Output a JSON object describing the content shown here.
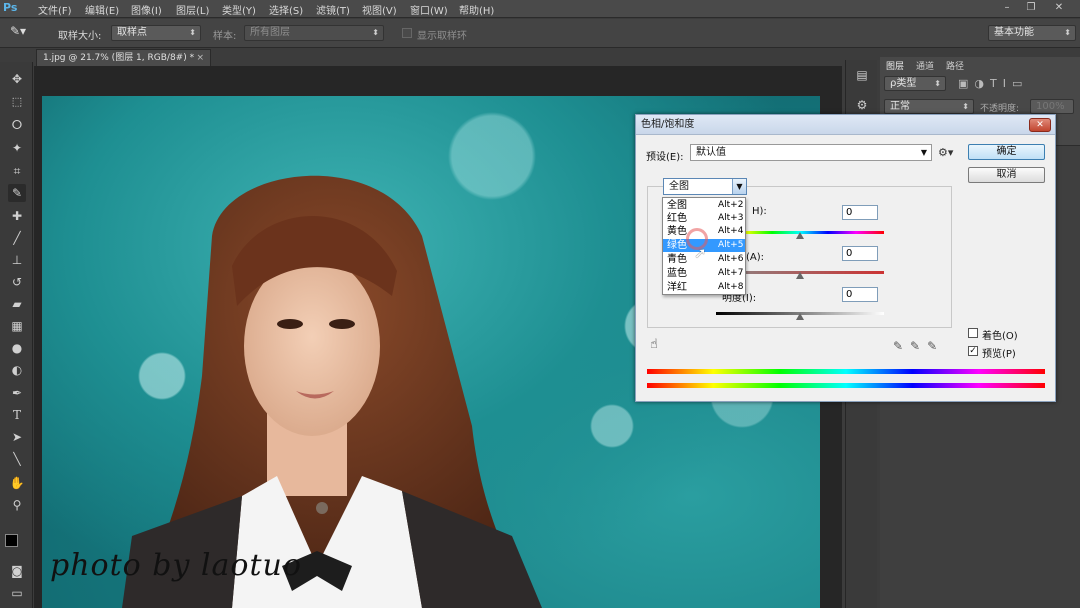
{
  "app": {
    "logo": "Ps"
  },
  "menu": [
    {
      "label": "文件(F)"
    },
    {
      "label": "编辑(E)"
    },
    {
      "label": "图像(I)"
    },
    {
      "label": "图层(L)"
    },
    {
      "label": "类型(Y)"
    },
    {
      "label": "选择(S)"
    },
    {
      "label": "滤镜(T)"
    },
    {
      "label": "视图(V)"
    },
    {
      "label": "窗口(W)"
    },
    {
      "label": "帮助(H)"
    }
  ],
  "window_controls": {
    "minimize": "–",
    "restore": "❐",
    "close": "✕"
  },
  "options_bar": {
    "sample_size_label": "取样大小:",
    "sample_size_value": "取样点",
    "sample_label": "样本:",
    "sample_value": "所有图层",
    "show_ring_label": "显示取样环",
    "workspace": "基本功能"
  },
  "document": {
    "tab_title": "1.jpg @ 21.7% (图层 1, RGB/8#) *",
    "tab_close": "×"
  },
  "photo": {
    "watermark": "photo by laotuo"
  },
  "layers_panel": {
    "tabs": [
      "图层",
      "通道",
      "路径"
    ],
    "kind_filter": "ρ类型",
    "blend_mode": "正常",
    "opacity_label": "不透明度:",
    "opacity_value": "100%"
  },
  "dialog": {
    "title": "色相/饱和度",
    "close": "✕",
    "preset_label": "预设(E):",
    "preset_value": "默认值",
    "ok": "确定",
    "cancel": "取消",
    "channel_selected": "全图",
    "hue_label_partial": "H):",
    "sat_label_partial": "度(A):",
    "light_label_partial": "明度(I):",
    "hue_value": "0",
    "saturation_value": "0",
    "lightness_value": "0",
    "colorize_label": "着色(O)",
    "preview_label": "预览(P)",
    "colorize_checked": false,
    "preview_checked": true,
    "channel_options": [
      {
        "label": "全图",
        "shortcut": "Alt+2"
      },
      {
        "label": "红色",
        "shortcut": "Alt+3"
      },
      {
        "label": "黄色",
        "shortcut": "Alt+4"
      },
      {
        "label": "绿色",
        "shortcut": "Alt+5"
      },
      {
        "label": "青色",
        "shortcut": "Alt+6"
      },
      {
        "label": "蓝色",
        "shortcut": "Alt+7"
      },
      {
        "label": "洋红",
        "shortcut": "Alt+8"
      }
    ],
    "highlighted_option": "绿色"
  },
  "colors": {
    "accent": "#3399ff",
    "dialog_bg": "#f0f0f0",
    "ui_dark": "#3c3c3c"
  }
}
